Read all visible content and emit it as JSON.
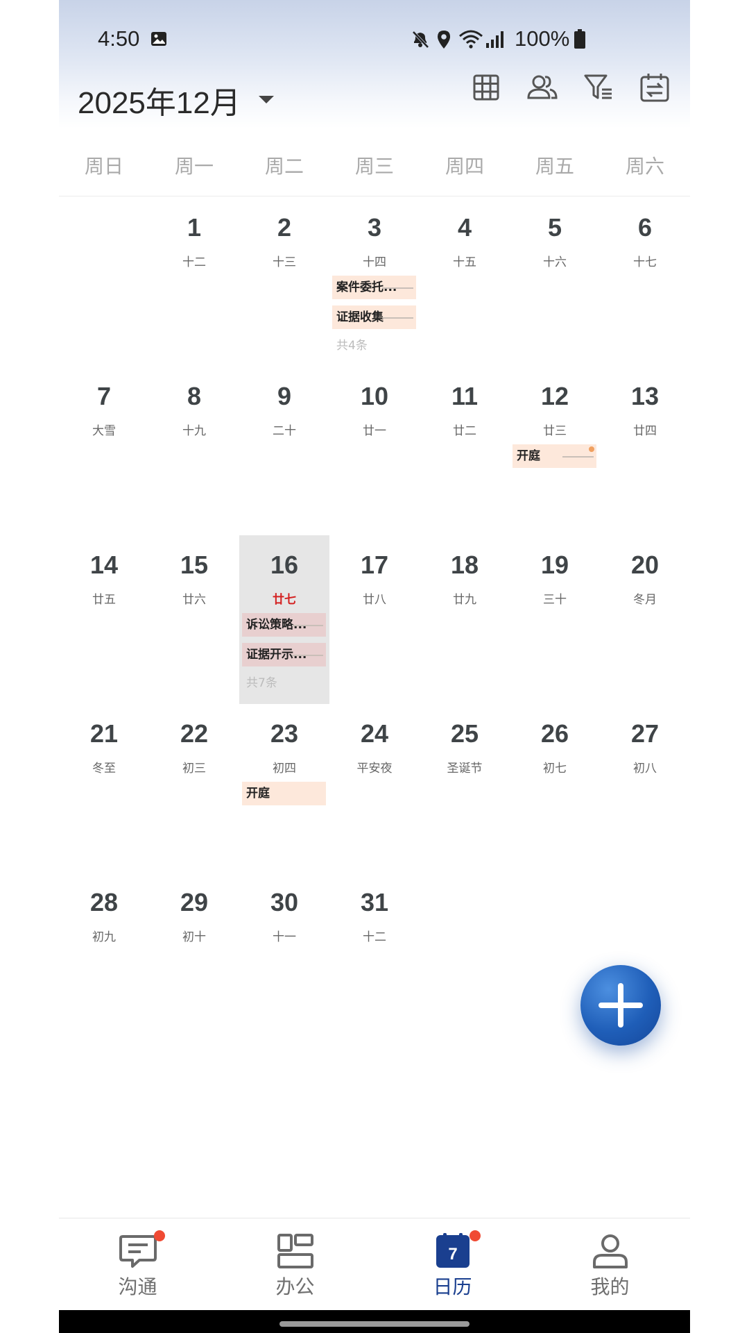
{
  "status_bar": {
    "time": "4:50",
    "battery": "100%"
  },
  "header": {
    "month_title": "2025年12月"
  },
  "weekdays": [
    "周日",
    "周一",
    "周二",
    "周三",
    "周四",
    "周五",
    "周六"
  ],
  "weeks": [
    [
      {
        "day": "",
        "lunar": ""
      },
      {
        "day": "1",
        "lunar": "十二"
      },
      {
        "day": "2",
        "lunar": "十三"
      },
      {
        "day": "3",
        "lunar": "十四",
        "events": [
          {
            "title": "案件委托...",
            "style": "peach"
          },
          {
            "title": "证据收集",
            "style": "peach"
          }
        ],
        "more": "共4条"
      },
      {
        "day": "4",
        "lunar": "十五"
      },
      {
        "day": "5",
        "lunar": "十六"
      },
      {
        "day": "6",
        "lunar": "十七"
      }
    ],
    [
      {
        "day": "7",
        "lunar": "大雪"
      },
      {
        "day": "8",
        "lunar": "十九"
      },
      {
        "day": "9",
        "lunar": "二十"
      },
      {
        "day": "10",
        "lunar": "廿一"
      },
      {
        "day": "11",
        "lunar": "廿二"
      },
      {
        "day": "12",
        "lunar": "廿三",
        "events": [
          {
            "title": "开庭",
            "style": "peach",
            "dot": true
          }
        ]
      },
      {
        "day": "13",
        "lunar": "廿四"
      }
    ],
    [
      {
        "day": "14",
        "lunar": "廿五"
      },
      {
        "day": "15",
        "lunar": "廿六"
      },
      {
        "day": "16",
        "lunar": "廿七",
        "today": true,
        "events": [
          {
            "title": "诉讼策略...",
            "style": "pink"
          },
          {
            "title": "证据开示...",
            "style": "pink"
          }
        ],
        "more": "共7条"
      },
      {
        "day": "17",
        "lunar": "廿八"
      },
      {
        "day": "18",
        "lunar": "廿九"
      },
      {
        "day": "19",
        "lunar": "三十"
      },
      {
        "day": "20",
        "lunar": "冬月"
      }
    ],
    [
      {
        "day": "21",
        "lunar": "冬至"
      },
      {
        "day": "22",
        "lunar": "初三"
      },
      {
        "day": "23",
        "lunar": "初四",
        "events": [
          {
            "title": "开庭",
            "style": "peach",
            "noline": true
          }
        ]
      },
      {
        "day": "24",
        "lunar": "平安夜"
      },
      {
        "day": "25",
        "lunar": "圣诞节"
      },
      {
        "day": "26",
        "lunar": "初七"
      },
      {
        "day": "27",
        "lunar": "初八"
      }
    ],
    [
      {
        "day": "28",
        "lunar": "初九"
      },
      {
        "day": "29",
        "lunar": "初十"
      },
      {
        "day": "30",
        "lunar": "十一"
      },
      {
        "day": "31",
        "lunar": "十二"
      },
      {
        "day": "",
        "lunar": ""
      },
      {
        "day": "",
        "lunar": ""
      },
      {
        "day": "",
        "lunar": ""
      }
    ]
  ],
  "bottom_nav": {
    "items": [
      {
        "label": "沟通",
        "icon": "chat-icon",
        "badge": true
      },
      {
        "label": "办公",
        "icon": "office-icon",
        "badge": false
      },
      {
        "label": "日历",
        "icon": "calendar-icon",
        "badge": true,
        "active": true,
        "icon_number": "7"
      },
      {
        "label": "我的",
        "icon": "profile-icon",
        "badge": false
      }
    ]
  },
  "colors": {
    "accent": "#1a3f8f",
    "today_lunar": "#d42222",
    "badge": "#f04a33",
    "fab": "#1f5eb8"
  }
}
